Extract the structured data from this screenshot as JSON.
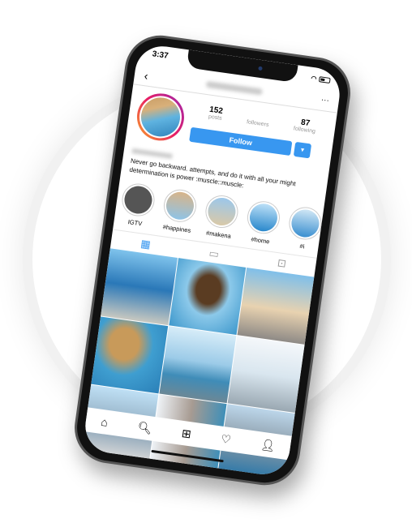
{
  "status": {
    "time": "3:37"
  },
  "header": {
    "back": "‹",
    "more": "···"
  },
  "profile": {
    "posts": "152",
    "posts_label": "posts",
    "followers_label": "followers",
    "following": "87",
    "following_label": "following",
    "follow_label": "Follow",
    "dropdown": "▼"
  },
  "bio": "Never go backward. attempts, and do it with all your might determination is power :muscle::muscle:",
  "highlights": [
    {
      "label": "IGTV"
    },
    {
      "label": "#happines"
    },
    {
      "label": "#makena"
    },
    {
      "label": "#home"
    },
    {
      "label": "#i"
    }
  ],
  "tabs": [
    {
      "icon": "grid-icon",
      "glyph": "▦"
    },
    {
      "icon": "tv-icon",
      "glyph": "▭"
    },
    {
      "icon": "tagged-icon",
      "glyph": "⊡"
    }
  ],
  "nav": [
    {
      "icon": "home-icon",
      "glyph": "⌂"
    },
    {
      "icon": "search-icon",
      "glyph": "🔍︎"
    },
    {
      "icon": "add-icon",
      "glyph": "⊞"
    },
    {
      "icon": "heart-icon",
      "glyph": "♡"
    },
    {
      "icon": "profile-icon",
      "glyph": "👤︎"
    }
  ],
  "colors": {
    "accent": "#3897f0"
  }
}
